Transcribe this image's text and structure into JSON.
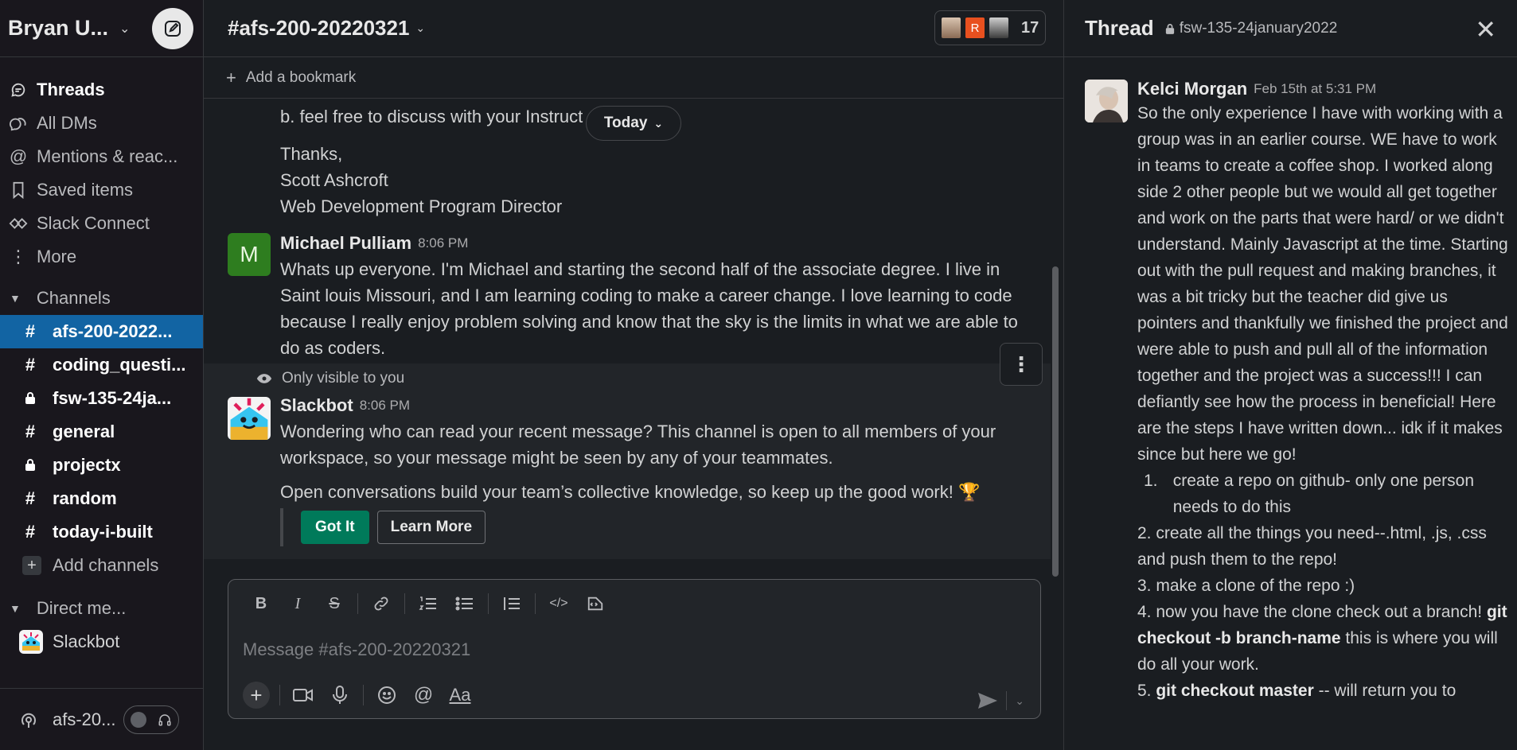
{
  "workspace": {
    "name": "Bryan U...",
    "compose_label": "compose-icon"
  },
  "nav": [
    {
      "label": "Threads",
      "icon": "threads-icon",
      "bold": true
    },
    {
      "label": "All DMs",
      "icon": "dms-icon",
      "bold": false
    },
    {
      "label": "Mentions & reac...",
      "icon": "at-icon",
      "bold": false
    },
    {
      "label": "Saved items",
      "icon": "bookmark-icon",
      "bold": false
    },
    {
      "label": "Slack Connect",
      "icon": "connect-icon",
      "bold": false
    },
    {
      "label": "More",
      "icon": "more-vertical-icon",
      "bold": false
    }
  ],
  "channels_section": {
    "label": "Channels"
  },
  "channels": [
    {
      "prefix": "#",
      "name": "afs-200-2022...",
      "active": true
    },
    {
      "prefix": "#",
      "name": "coding_questi...",
      "active": false
    },
    {
      "prefix": "🔒",
      "name": "fsw-135-24ja...",
      "active": false
    },
    {
      "prefix": "#",
      "name": "general",
      "active": false
    },
    {
      "prefix": "🔒",
      "name": "projectx",
      "active": false
    },
    {
      "prefix": "#",
      "name": "random",
      "active": false
    },
    {
      "prefix": "#",
      "name": "today-i-built",
      "active": false
    }
  ],
  "add_channels": "Add channels",
  "dm_section": {
    "label": "Direct me..."
  },
  "dms": [
    {
      "name": "Slackbot"
    }
  ],
  "huddle": {
    "channel": "afs-20..."
  },
  "channel": {
    "title": "#afs-200-20220321",
    "member_count": "17",
    "add_bookmark": "Add a bookmark",
    "today_pill": "Today"
  },
  "messages": {
    "cont_line": "b. feel free to discuss with your Instruct",
    "sig_1": "Thanks,",
    "sig_2": "Scott Ashcroft",
    "sig_3": "Web Development Program Director",
    "m1": {
      "avatar_letter": "M",
      "sender": "Michael Pulliam",
      "time": "8:06 PM",
      "text": "Whats up everyone. I'm Michael and starting the second half of the associate degree. I live in Saint louis Missouri, and I am learning coding to make a career change. I love learning to code because I really enjoy problem solving and know that the sky is the limits in what we are able to do as coders."
    },
    "m2": {
      "visibility": "Only visible to you",
      "sender": "Slackbot",
      "time": "8:06 PM",
      "text": "Wondering who can read your recent message? This channel is open to all members of your workspace, so your message might be seen by any of your teammates.",
      "text2": "Open conversations build your team’s collective knowledge, so keep up the good work! 🏆",
      "btn_primary": "Got It",
      "btn_secondary": "Learn More"
    }
  },
  "composer": {
    "placeholder": "Message #afs-200-20220321"
  },
  "thread": {
    "title": "Thread",
    "channel": "fsw-135-24january2022",
    "sender": "Kelci Morgan",
    "time": "Feb 15th at 5:31 PM",
    "intro": "So the only experience I have with working with a group was in an earlier course. WE have to work in teams to create a coffee shop. I worked along side 2 other people but we would all get together and work on the parts that were hard/ or we didn't understand. Mainly Javascript at the time. Starting out with the pull request and making branches, it was a bit tricky but the teacher did give us pointers and thankfully we finished the project and were able to push and pull all of the information together and the project was a success!!! I can defiantly see how the process in beneficial! Here are the steps I have written down... idk if it makes since but here we go!",
    "step1_num": "1.",
    "step1": "create a repo on github- only one person needs to do this",
    "step2": "2. create all the things you need--.html, .js, .css and push them to the repo!",
    "step3": "3. make a clone of the repo :)",
    "step4_pre": "4.  now you have the clone check out a branch! ",
    "step4_code": "git checkout -b branch-name",
    "step4_post": " this is where you will do all your work.",
    "step5_pre": "5. ",
    "step5_code": "git checkout master",
    "step5_post": " -- will return you to"
  }
}
